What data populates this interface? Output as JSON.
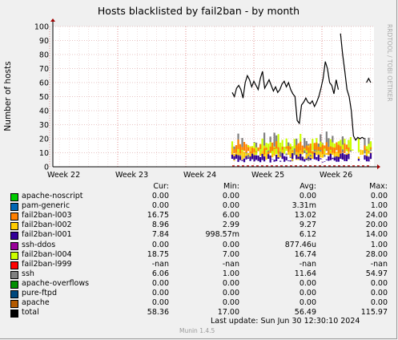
{
  "chart_data": {
    "type": "line",
    "title": "Hosts blacklisted by fail2ban - by month",
    "ylabel": "Number of hosts",
    "xlabel": "",
    "watermark": "RRDTOOL / TOBI OETIKER",
    "ylim": [
      0,
      100
    ],
    "yticks": [
      "0",
      "10",
      "20",
      "30",
      "40",
      "50",
      "60",
      "70",
      "80",
      "90",
      "100"
    ],
    "xticks": [
      "Week 22",
      "Week 23",
      "Week 24",
      "Week 25",
      "Week 26"
    ],
    "grid": true,
    "legend_columns": [
      "Cur:",
      "Min:",
      "Avg:",
      "Max:"
    ],
    "series": [
      {
        "name": "apache-noscript",
        "color": "#00cc00",
        "cur": "0.00",
        "min": "0.00",
        "avg": "0.00",
        "max": "0.00"
      },
      {
        "name": "pam-generic",
        "color": "#0066b3",
        "cur": "0.00",
        "min": "0.00",
        "avg": "3.31m",
        "max": "1.00"
      },
      {
        "name": "fail2ban-l003",
        "color": "#ff8000",
        "cur": "16.75",
        "min": "6.00",
        "avg": "13.02",
        "max": "24.00"
      },
      {
        "name": "fail2ban-l002",
        "color": "#ffcc00",
        "cur": "8.96",
        "min": "2.99",
        "avg": "9.27",
        "max": "20.00"
      },
      {
        "name": "fail2ban-l001",
        "color": "#330099",
        "cur": "7.84",
        "min": "998.57m",
        "avg": "6.12",
        "max": "14.00"
      },
      {
        "name": "ssh-ddos",
        "color": "#990099",
        "cur": "0.00",
        "min": "0.00",
        "avg": "877.46u",
        "max": "1.00"
      },
      {
        "name": "fail2ban-l004",
        "color": "#ccff00",
        "cur": "18.75",
        "min": "7.00",
        "avg": "16.74",
        "max": "28.00"
      },
      {
        "name": "fail2ban-l999",
        "color": "#ff0000",
        "cur": "-nan",
        "min": "-nan",
        "avg": "-nan",
        "max": "-nan"
      },
      {
        "name": "ssh",
        "color": "#808080",
        "cur": "6.06",
        "min": "1.00",
        "avg": "11.64",
        "max": "54.97"
      },
      {
        "name": "apache-overflows",
        "color": "#008f00",
        "cur": "0.00",
        "min": "0.00",
        "avg": "0.00",
        "max": "0.00"
      },
      {
        "name": "pure-ftpd",
        "color": "#00487d",
        "cur": "0.00",
        "min": "0.00",
        "avg": "0.00",
        "max": "0.00"
      },
      {
        "name": "apache",
        "color": "#b35a00",
        "cur": "0.00",
        "min": "0.00",
        "avg": "0.00",
        "max": "0.00"
      },
      {
        "name": "total",
        "color": "#000000",
        "cur": "58.36",
        "min": "17.00",
        "avg": "56.49",
        "max": "115.97"
      }
    ],
    "total_profile": [
      [
        0.0,
        53
      ],
      [
        0.2,
        50
      ],
      [
        0.4,
        56
      ],
      [
        0.6,
        58
      ],
      [
        0.8,
        55
      ],
      [
        1.0,
        49
      ],
      [
        1.2,
        60
      ],
      [
        1.4,
        65
      ],
      [
        1.6,
        62
      ],
      [
        1.8,
        57
      ],
      [
        2.0,
        61
      ],
      [
        2.2,
        58
      ],
      [
        2.4,
        55
      ],
      [
        2.6,
        63
      ],
      [
        2.8,
        68
      ],
      [
        3.0,
        56
      ],
      [
        3.2,
        59
      ],
      [
        3.4,
        62
      ],
      [
        3.6,
        58
      ],
      [
        3.8,
        54
      ],
      [
        4.0,
        57
      ],
      [
        4.2,
        53
      ],
      [
        4.4,
        55
      ],
      [
        4.6,
        59
      ],
      [
        4.8,
        61
      ],
      [
        5.0,
        57
      ],
      [
        5.2,
        60
      ],
      [
        5.4,
        55
      ],
      [
        5.6,
        52
      ],
      [
        5.8,
        50
      ],
      [
        6.0,
        33
      ],
      [
        6.2,
        31
      ],
      [
        6.4,
        44
      ],
      [
        6.6,
        46
      ],
      [
        6.8,
        49
      ],
      [
        7.0,
        46
      ],
      [
        7.2,
        45
      ],
      [
        7.4,
        47
      ],
      [
        7.6,
        43
      ],
      [
        7.8,
        46
      ],
      [
        8.0,
        50
      ],
      [
        8.2,
        56
      ],
      [
        8.4,
        63
      ],
      [
        8.6,
        75
      ],
      [
        8.8,
        70
      ],
      [
        9.0,
        60
      ],
      [
        9.2,
        58
      ],
      [
        9.4,
        52
      ],
      [
        9.6,
        62
      ],
      [
        9.8,
        55
      ],
      [
        10.0,
        95
      ],
      [
        10.2,
        80
      ],
      [
        10.4,
        68
      ],
      [
        10.6,
        55
      ],
      [
        10.8,
        50
      ],
      [
        11.0,
        40
      ],
      [
        11.2,
        22
      ],
      [
        11.4,
        19
      ],
      [
        11.6,
        21
      ],
      [
        11.8,
        20
      ],
      [
        12.0,
        21
      ],
      [
        12.2,
        20
      ],
      [
        12.4,
        60
      ],
      [
        12.6,
        63
      ],
      [
        12.8,
        60
      ]
    ]
  },
  "footer": {
    "last_update": "Last update:  Sun Jun 30 12:30:10 2024",
    "version": "Munin 1.4.5"
  }
}
